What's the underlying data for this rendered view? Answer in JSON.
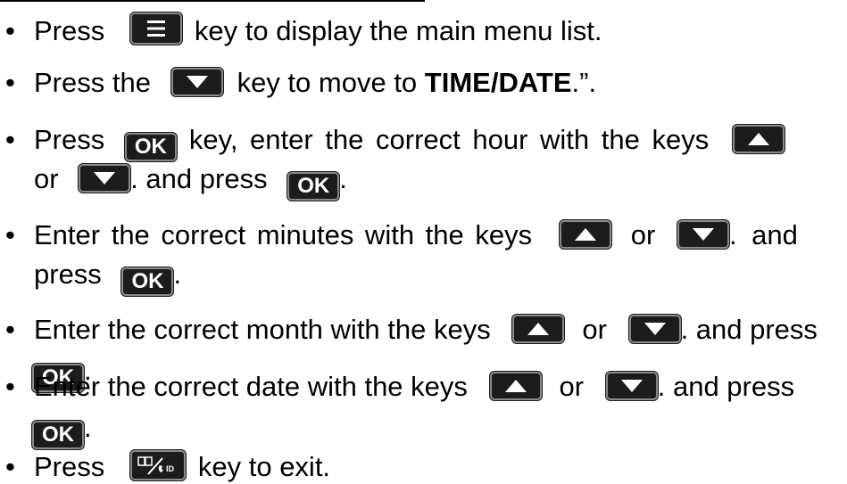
{
  "bullet": "•",
  "ok_label": "OK",
  "book_key_id": "ID",
  "icons": {
    "menu_key": "menu-list-key-icon",
    "up_key": "up-arrow-key-icon",
    "down_key": "down-arrow-key-icon",
    "ok_key": "ok-key",
    "phonebook_key": "phonebook-callerid-key-icon"
  },
  "steps": [
    {
      "p1": "Press",
      "p2": "key to display the main menu list."
    },
    {
      "p1": "Press the",
      "p2": "key to move to",
      "bold": "TIME/DATE",
      "p3": ".”."
    },
    {
      "p1": "Press",
      "p2": "key, enter the correct hour with the keys",
      "p3": "or",
      "p4": ". and press",
      "p5": "."
    },
    {
      "p1": "Enter the correct minutes with the keys",
      "p2": "or",
      "p3": ". and",
      "p4": "press",
      "p5": "."
    },
    {
      "p1": "Enter the correct month with the keys",
      "p2": "or",
      "p3": ". and press",
      "p4": "."
    },
    {
      "p1": "Enter the correct date with the keys",
      "p2": "or",
      "p3": ". and press",
      "p4": "."
    },
    {
      "p1": "Press",
      "p2": "key to exit."
    }
  ]
}
